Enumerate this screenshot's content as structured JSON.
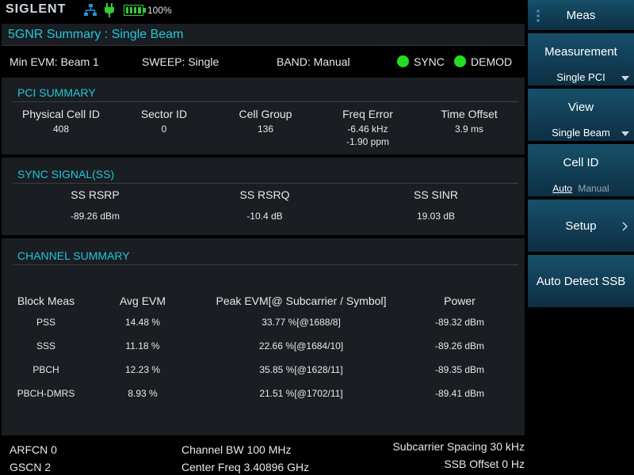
{
  "topbar": {
    "logo": "SIGLENT",
    "battery": "100%"
  },
  "title": "5GNR Summary : Single Beam",
  "status": {
    "min_evm": "Min EVM: Beam 1",
    "sweep": "SWEEP: Single",
    "band": "BAND: Manual",
    "sync": "SYNC",
    "demod": "DEMOD",
    "indicator_color": "#22dd22"
  },
  "pci_summary": {
    "heading": "PCI SUMMARY",
    "columns": [
      {
        "label": "Physical Cell ID",
        "value": "408",
        "value2": ""
      },
      {
        "label": "Sector ID",
        "value": "0",
        "value2": ""
      },
      {
        "label": "Cell Group",
        "value": "136",
        "value2": ""
      },
      {
        "label": "Freq Error",
        "value": "-6.46 kHz",
        "value2": "-1.90 ppm"
      },
      {
        "label": "Time Offset",
        "value": "3.9 ms",
        "value2": ""
      }
    ]
  },
  "sync_signal": {
    "heading": "SYNC SIGNAL(SS)",
    "columns": [
      {
        "label": "SS RSRP",
        "value": "-89.26 dBm"
      },
      {
        "label": "SS RSRQ",
        "value": "-10.4 dB"
      },
      {
        "label": "SS SINR",
        "value": "19.03 dB"
      }
    ]
  },
  "channel_summary": {
    "heading": "CHANNEL SUMMARY",
    "headers": [
      "Block Meas",
      "Avg EVM",
      "Peak EVM[@ Subcarrier / Symbol]",
      "Power"
    ],
    "rows": [
      [
        "PSS",
        "14.48 %",
        "33.77 %[@1688/8]",
        "-89.32 dBm"
      ],
      [
        "SSS",
        "11.18 %",
        "22.66 %[@1684/10]",
        "-89.26 dBm"
      ],
      [
        "PBCH",
        "12.23 %",
        "35.85 %[@1628/11]",
        "-89.35 dBm"
      ],
      [
        "PBCH-DMRS",
        "8.93 %",
        "21.51 %[@1702/11]",
        "-89.41 dBm"
      ]
    ]
  },
  "bottom": {
    "arfcn": "ARFCN  0",
    "gscn": "GSCN  2",
    "channel_bw": "Channel BW  100 MHz",
    "center_freq": "Center Freq  3.40896 GHz",
    "subcarrier_spacing": "Subcarrier Spacing  30 kHz",
    "ssb_offset": "SSB Offset  0 Hz"
  },
  "sidebar": {
    "menu_title": "Meas",
    "measurement_label": "Measurement",
    "measurement_value": "Single PCI",
    "view_label": "View",
    "view_value": "Single Beam",
    "cellid_label": "Cell ID",
    "cellid_auto": "Auto",
    "cellid_manual": "Manual",
    "setup_label": "Setup",
    "auto_detect_label": "Auto Detect SSB"
  },
  "colors": {
    "accent": "#20c8d8",
    "panel_bg": "#1a1d22",
    "sidebar_top": "#17506a",
    "sidebar_bottom": "#0d2f44"
  },
  "icons": [
    "network-icon",
    "plug-icon",
    "battery-icon",
    "menu-dots-icon",
    "dropdown-arrow-icon",
    "chevron-right-icon"
  ]
}
